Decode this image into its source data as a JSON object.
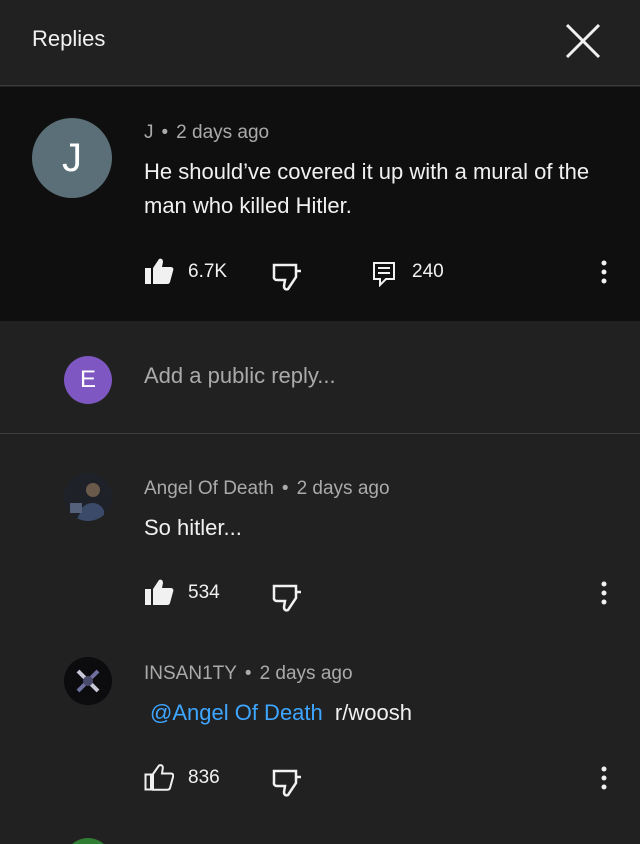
{
  "header": {
    "title": "Replies",
    "close_icon": "close-icon"
  },
  "parent_comment": {
    "avatar_letter": "J",
    "author": "J",
    "separator": "•",
    "time": "2 days ago",
    "text": "He should’ve covered it up with a mural of the man who killed Hitler.",
    "likes": "6.7K",
    "replies": "240"
  },
  "reply_box": {
    "avatar_letter": "E",
    "placeholder": "Add a public reply..."
  },
  "replies": [
    {
      "author": "Angel Of Death",
      "separator": "•",
      "time": "2 days ago",
      "text": "So hitler...",
      "likes": "534"
    },
    {
      "author": "INSAN1TY",
      "separator": "•",
      "time": "2 days ago",
      "mention": "@Angel Of Death",
      "text": "r/woosh",
      "likes": "836"
    }
  ],
  "colors": {
    "accent_link": "#3ea6ff",
    "avatar_j": "#5a6f78",
    "avatar_e": "#7e57c2"
  }
}
